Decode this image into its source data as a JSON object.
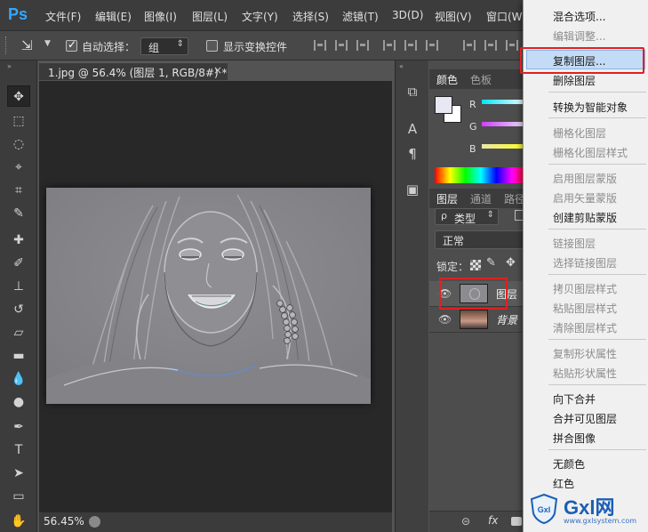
{
  "app": {
    "logo": "Ps"
  },
  "menubar": {
    "items": [
      "文件(F)",
      "编辑(E)",
      "图像(I)",
      "图层(L)",
      "文字(Y)",
      "选择(S)",
      "滤镜(T)",
      "3D(D)",
      "视图(V)",
      "窗口(W"
    ]
  },
  "options": {
    "auto_select_label": "自动选择：",
    "auto_select_value": "组",
    "show_transform_label": "显示变换控件"
  },
  "document": {
    "tab_title": "1.jpg @ 56.4% (图层 1, RGB/8#) *",
    "tab_close": "×",
    "zoom": "56.45%"
  },
  "panels": {
    "color_tabs": [
      "颜色",
      "色板"
    ],
    "channels": [
      "R",
      "G",
      "B"
    ],
    "layer_tabs": [
      "图层",
      "通道",
      "路径"
    ],
    "filter_label": "类型",
    "blend_mode": "正常",
    "lock_label": "锁定：",
    "layers": [
      {
        "name": "图层",
        "selected": true
      },
      {
        "name": "背景",
        "selected": false
      }
    ],
    "footer_fx": "fx"
  },
  "context_menu": {
    "items": [
      {
        "label": "混合选项...",
        "enabled": true
      },
      {
        "label": "编辑调整...",
        "enabled": false
      },
      {
        "label": "复制图层...",
        "enabled": true,
        "highlighted": true
      },
      {
        "label": "删除图层",
        "enabled": true
      },
      {
        "label": "转换为智能对象",
        "enabled": true
      },
      {
        "label": "栅格化图层",
        "enabled": false
      },
      {
        "label": "栅格化图层样式",
        "enabled": false
      },
      {
        "label": "启用图层蒙版",
        "enabled": false
      },
      {
        "label": "启用矢量蒙版",
        "enabled": false
      },
      {
        "label": "创建剪贴蒙版",
        "enabled": true
      },
      {
        "label": "链接图层",
        "enabled": false
      },
      {
        "label": "选择链接图层",
        "enabled": false
      },
      {
        "label": "拷贝图层样式",
        "enabled": false
      },
      {
        "label": "粘贴图层样式",
        "enabled": false
      },
      {
        "label": "清除图层样式",
        "enabled": false
      },
      {
        "label": "复制形状属性",
        "enabled": false
      },
      {
        "label": "粘贴形状属性",
        "enabled": false
      },
      {
        "label": "向下合并",
        "enabled": true
      },
      {
        "label": "合并可见图层",
        "enabled": true
      },
      {
        "label": "拼合图像",
        "enabled": true
      },
      {
        "label": "无颜色",
        "enabled": true
      },
      {
        "label": "红色",
        "enabled": true
      }
    ]
  },
  "watermark": {
    "brand": "Gxl网",
    "url": "www.gxlsystem.com"
  },
  "colors": {
    "accent": "#31a8ff",
    "highlight": "#c4dbf5",
    "annotation": "#e02020"
  }
}
